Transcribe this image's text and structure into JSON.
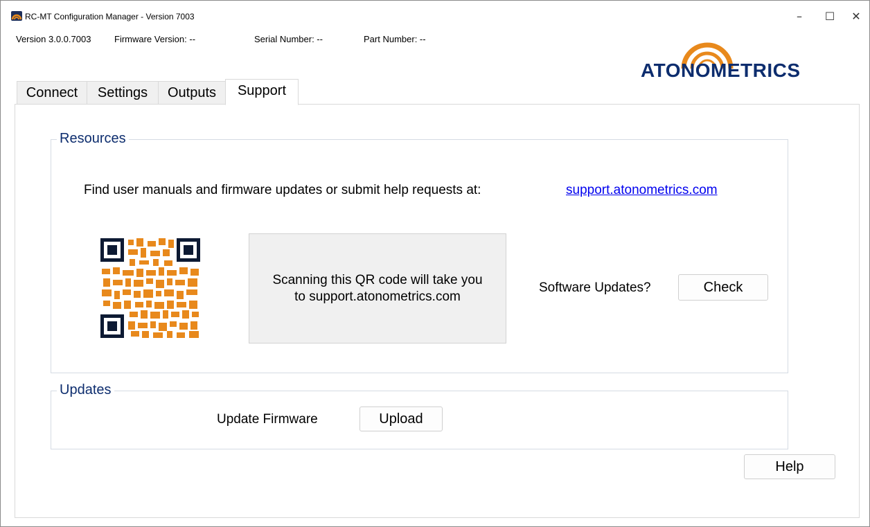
{
  "window": {
    "title": "RC-MT Configuration Manager - Version 7003",
    "controls": {
      "minimize": "–",
      "maximize": "☐",
      "close": "✕"
    }
  },
  "info_bar": {
    "version": "Version 3.0.0.7003",
    "firmware": "Firmware Version: --",
    "serial": "Serial Number: --",
    "part": "Part Number: --"
  },
  "logo": {
    "text": "ATONOMETRICS",
    "color": "#0d2d6e",
    "accent": "#e8891c"
  },
  "tabs": [
    {
      "label": "Connect",
      "active": false
    },
    {
      "label": "Settings",
      "active": false
    },
    {
      "label": "Outputs",
      "active": false
    },
    {
      "label": "Support",
      "active": true
    }
  ],
  "resources": {
    "title": "Resources",
    "description": "Find user manuals and firmware updates or submit help requests at:",
    "link": "support.atonometrics.com",
    "qr_caption_line1": "Scanning this QR code will take you",
    "qr_caption_line2": "to support.atonometrics.com",
    "software_updates_label": "Software Updates?",
    "check_button": "Check"
  },
  "updates": {
    "title": "Updates",
    "firmware_label": "Update Firmware",
    "upload_button": "Upload"
  },
  "help_button": "Help",
  "colors": {
    "group_title": "#0d2d6e",
    "qr_orange": "#e8891c",
    "qr_dark": "#0d1a33",
    "link": "#0000ee"
  }
}
